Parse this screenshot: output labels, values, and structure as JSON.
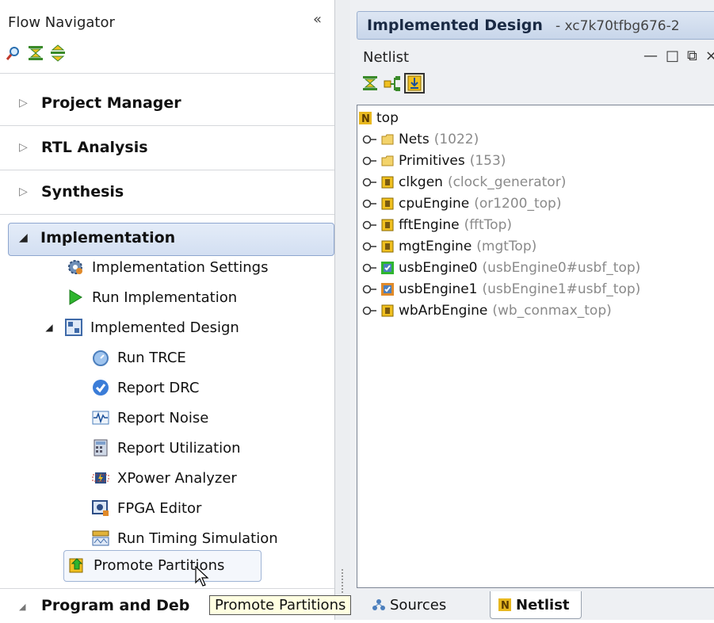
{
  "flow_navigator": {
    "title": "Flow Navigator",
    "collapse_glyph": "«",
    "toolbar_icons": [
      "search-icon",
      "collapse-all-icon",
      "expand-all-icon"
    ],
    "sections": [
      {
        "label": "Project Manager",
        "expanded": false
      },
      {
        "label": "RTL Analysis",
        "expanded": false
      },
      {
        "label": "Synthesis",
        "expanded": false
      },
      {
        "label": "Implementation",
        "expanded": true,
        "selected": true
      },
      {
        "label": "Program and Debug",
        "expanded": true
      }
    ],
    "implementation_items": [
      {
        "label": "Implementation Settings",
        "icon": "settings-gear-icon"
      },
      {
        "label": "Run Implementation",
        "icon": "run-play-icon"
      },
      {
        "label": "Implemented Design",
        "icon": "design-layout-icon"
      }
    ],
    "implemented_design_items": [
      {
        "label": "Run TRCE",
        "icon": "stopwatch-icon"
      },
      {
        "label": "Report DRC",
        "icon": "check-circle-icon"
      },
      {
        "label": "Report Noise",
        "icon": "waveform-icon"
      },
      {
        "label": "Report Utilization",
        "icon": "calculator-icon"
      },
      {
        "label": "XPower Analyzer",
        "icon": "power-chip-icon"
      },
      {
        "label": "FPGA Editor",
        "icon": "fpga-editor-icon"
      },
      {
        "label": "Run Timing Simulation",
        "icon": "timing-sim-icon"
      }
    ],
    "promote_partitions": {
      "label": "Promote Partitions",
      "icon": "promote-arrow-icon"
    },
    "tooltip": "Promote Partitions",
    "program_debug_visible": "Program and Deb"
  },
  "design_panel": {
    "title": "Implemented Design",
    "subtitle": "- xc7k70tfbg676-2",
    "netlist_title": "Netlist",
    "window_buttons": [
      "minimize-icon",
      "maximize-icon",
      "restore-icon",
      "close-icon"
    ],
    "window_glyphs": [
      "—",
      "□",
      "⧉",
      "×"
    ],
    "toolbar_icons": [
      "collapse-all-icon",
      "show-hierarchy-icon",
      "auto-expand-icon"
    ]
  },
  "netlist": {
    "root": "top",
    "rows": [
      {
        "name": "Nets",
        "sub": "(1022)",
        "icon": "folder"
      },
      {
        "name": "Primitives",
        "sub": "(153)",
        "icon": "folder"
      },
      {
        "name": "clkgen",
        "sub": "(clock_generator)",
        "icon": "cell"
      },
      {
        "name": "cpuEngine",
        "sub": "(or1200_top)",
        "icon": "cell"
      },
      {
        "name": "fftEngine",
        "sub": "(fftTop)",
        "icon": "cell"
      },
      {
        "name": "mgtEngine",
        "sub": "(mgtTop)",
        "icon": "cell"
      },
      {
        "name": "usbEngine0",
        "sub": "(usbEngine0#usbf_top)",
        "icon": "partition-green"
      },
      {
        "name": "usbEngine1",
        "sub": "(usbEngine1#usbf_top)",
        "icon": "partition-orange"
      },
      {
        "name": "wbArbEngine",
        "sub": "(wb_conmax_top)",
        "icon": "cell"
      }
    ]
  },
  "bottom_tabs": [
    {
      "label": "Sources",
      "icon": "sources-icon",
      "active": false
    },
    {
      "label": "Netlist",
      "icon": "netlist-n-icon",
      "active": true
    }
  ]
}
